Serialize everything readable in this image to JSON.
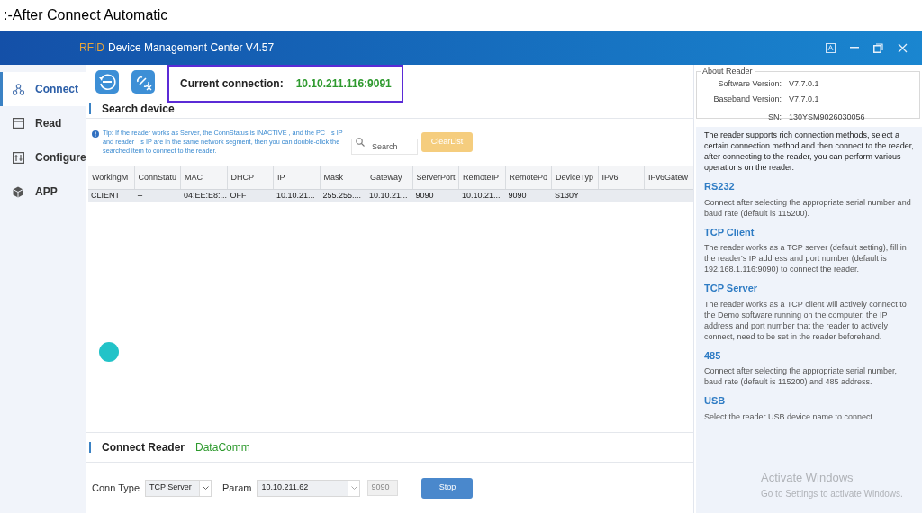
{
  "caption": ":-After Connect Automatic",
  "window": {
    "brand": "RFID",
    "title": "Device Management Center V4.57"
  },
  "sidebar": {
    "items": [
      {
        "label": "Connect",
        "selected": true
      },
      {
        "label": "Read",
        "selected": false
      },
      {
        "label": "Configure",
        "selected": false
      },
      {
        "label": "APP",
        "selected": false
      }
    ]
  },
  "toolbar": {
    "connection_label": "Current connection:",
    "connection_value": "10.10.211.116:9091"
  },
  "search_device": {
    "heading": "Search device",
    "tip": "Tip: If the reader works as Server, the ConnStatus is INACTIVE , and the PC　s IP and reader　s IP are in the same network segment, then you can double-click the searched item to connect to the reader.",
    "search_placeholder": "Search",
    "clear_button": "ClearList"
  },
  "table": {
    "columns": [
      "WorkingM",
      "ConnStatu",
      "MAC",
      "DHCP",
      "IP",
      "Mask",
      "Gateway",
      "ServerPort",
      "RemoteIP",
      "RemotePo",
      "DeviceTyp",
      "IPv6",
      "IPv6Gatew"
    ],
    "rows": [
      [
        "CLIENT",
        "--",
        "04:EE:E8:...",
        "OFF",
        "10.10.21...",
        "255.255....",
        "10.10.21...",
        "9090",
        "10.10.21...",
        "9090",
        "S130Y",
        "",
        ""
      ]
    ]
  },
  "connect_reader": {
    "heading": "Connect Reader",
    "tab": "DataComm",
    "conn_type_label": "Conn Type",
    "conn_type": "TCP Server",
    "param_label": "Param",
    "param": "10.10.211.62",
    "port": "9090",
    "stop_button": "Stop"
  },
  "about_reader": {
    "title": "About Reader",
    "rows": [
      {
        "label": "Software Version:",
        "value": "V7.7.0.1"
      },
      {
        "label": "Baseband Version:",
        "value": "V7.7.0.1"
      },
      {
        "label": "SN:",
        "value": "130YSM9026030056"
      }
    ]
  },
  "help": {
    "intro": "The reader supports rich connection methods, select a certain connection method and then connect to the reader, after connecting to the reader, you can perform various operations on the reader.",
    "sections": [
      {
        "title": "RS232",
        "text": "Connect after selecting the appropriate serial number and baud rate (default is 115200)."
      },
      {
        "title": "TCP Client",
        "text": "The reader works as a TCP server (default setting), fill in the reader's IP address and port number (default is 192.168.1.116:9090) to connect the reader."
      },
      {
        "title": "TCP Server",
        "text": "The reader works as a TCP client will actively connect to the Demo software running on the computer, the IP address and port number that the reader to actively connect, need  to be set in the reader beforehand."
      },
      {
        "title": "485",
        "text": "Connect after selecting the appropriate serial number, baud rate (default is 115200) and 485 address."
      },
      {
        "title": "USB",
        "text": "Select the reader USB device name to connect."
      }
    ]
  },
  "os_notice": {
    "title": "Activate Windows",
    "subtitle": "Go to Settings to activate Windows."
  }
}
